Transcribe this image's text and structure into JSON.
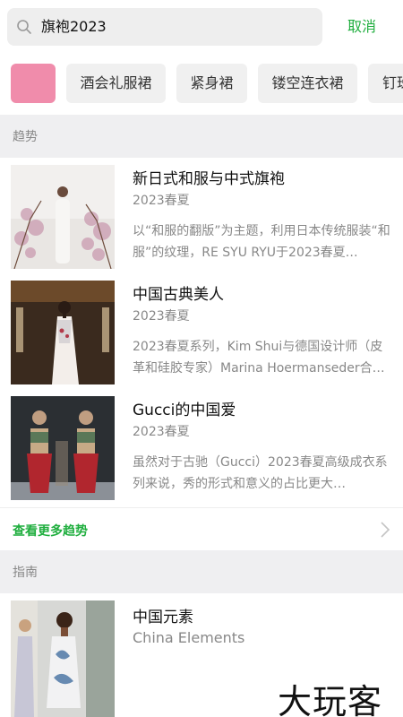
{
  "search": {
    "query": "旗袍2023",
    "cancel_label": "取消"
  },
  "chips": [
    {
      "label": ""
    },
    {
      "label": "酒会礼服裙"
    },
    {
      "label": "紧身裙"
    },
    {
      "label": "镂空连衣裙"
    },
    {
      "label": "钉珠"
    }
  ],
  "colors": {
    "accent": "#1fae3e",
    "swatch": "#f08cab",
    "section_bg": "#efeff1"
  },
  "trends": {
    "header": "趋势",
    "items": [
      {
        "title": "新日式和服与中式旗袍",
        "season": "2023春夏",
        "desc": "以“和服的翻版”为主题，利用日本传统服装“和服”的纹理，RE SYU RYU于2023春夏…"
      },
      {
        "title": "中国古典美人",
        "season": "2023春夏",
        "desc": "2023春夏系列，Kim Shui与德国设计师（皮革和硅胶专家）Marina Hoermanseder合…"
      },
      {
        "title": "Gucci的中国爱",
        "season": "2023春夏",
        "desc": "虽然对于古驰（Gucci）2023春夏高级成衣系列来说，秀的形式和意义的占比更大…"
      }
    ],
    "more_label": "查看更多趋势"
  },
  "guide": {
    "header": "指南",
    "items": [
      {
        "title": "中国元素",
        "subtitle": "China Elements"
      }
    ]
  },
  "watermark": "大玩客"
}
